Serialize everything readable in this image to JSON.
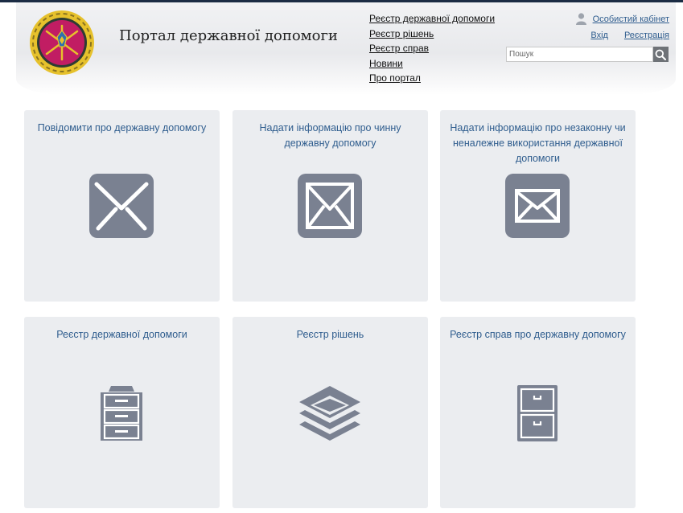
{
  "header": {
    "title": "Портал державної допомоги",
    "nav": [
      "Реєстр державної допомоги",
      "Реєстр рішень",
      "Реєстр справ",
      "Новини",
      "Про портал"
    ],
    "cabinet_label": "Особистий кабінет",
    "login_label": "Вхід",
    "register_label": "Реєстрація",
    "search_placeholder": "Пошук"
  },
  "cards": [
    {
      "title": "Повідомити про державну допомогу",
      "icon": "envelope-open-icon"
    },
    {
      "title": "Надати інформацію про чинну державну допомогу",
      "icon": "envelope-icon"
    },
    {
      "title": "Надати інформацію про незаконну чи неналежне використання державної допомоги",
      "icon": "envelope-icon"
    },
    {
      "title": "Реєстр державної допомоги",
      "icon": "filing-cabinet-icon"
    },
    {
      "title": "Реєстр рішень",
      "icon": "layers-icon"
    },
    {
      "title": "Реєстр справ про державну допомогу",
      "icon": "archive-cabinet-icon"
    }
  ],
  "colors": {
    "accent_link": "#2f5d8e",
    "card_bg": "#ebedf0",
    "icon": "#7a8191",
    "topline": "#1b2c44"
  }
}
